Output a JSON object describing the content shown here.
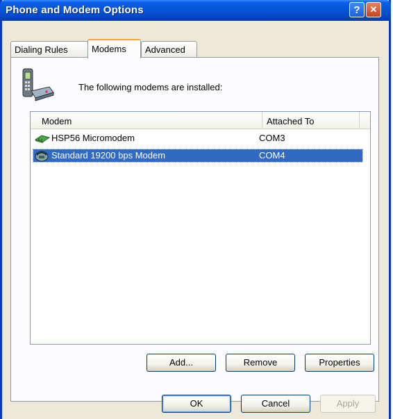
{
  "window": {
    "title": "Phone and Modem Options"
  },
  "title_buttons": {
    "help_label": "?",
    "close_label": "✕"
  },
  "tabs": [
    {
      "label": "Dialing Rules"
    },
    {
      "label": "Modems"
    },
    {
      "label": "Advanced"
    }
  ],
  "active_tab": "Modems",
  "intro_text": "The following modems are  installed:",
  "modem_list": {
    "columns": [
      "Modem",
      "Attached To"
    ],
    "rows": [
      {
        "name": "HSP56 Micromodem",
        "port": "COM3",
        "icon": "micromodem-icon",
        "selected": false
      },
      {
        "name": "Standard 19200 bps Modem",
        "port": "COM4",
        "icon": "standard-modem-icon",
        "selected": true
      }
    ]
  },
  "list_buttons": {
    "add": "Add...",
    "remove": "Remove",
    "properties": "Properties"
  },
  "dialog_buttons": {
    "ok": "OK",
    "cancel": "Cancel",
    "apply": "Apply",
    "apply_enabled": false
  },
  "colors": {
    "titlebar": "#0548c4",
    "selection": "#316ac5",
    "active_tab_accent": "#f7a533"
  }
}
